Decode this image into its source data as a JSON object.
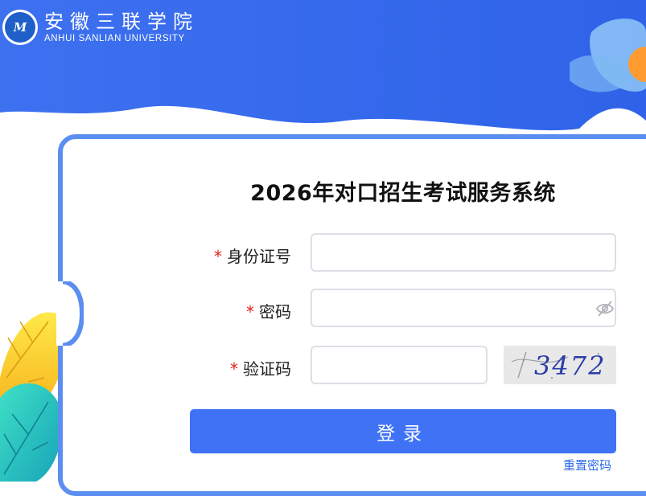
{
  "brand": {
    "name_cn": "安徽三联学院",
    "name_en": "ANHUI SANLIAN UNIVERSITY",
    "logo_mark": "M"
  },
  "form": {
    "title": "2026年对口招生考试服务系统",
    "required_mark": "*",
    "id_label": "身份证号",
    "password_label": "密码",
    "captcha_label": "验证码",
    "captcha_code": "3472",
    "login_button": "登录",
    "reset_link": "重置密码"
  },
  "colors": {
    "header_blue": "#3a6fee",
    "accent": "#3f72f5",
    "required": "#e02020",
    "link": "#2f6ae6"
  },
  "icons": {
    "password_toggle": "eye-off-icon"
  }
}
